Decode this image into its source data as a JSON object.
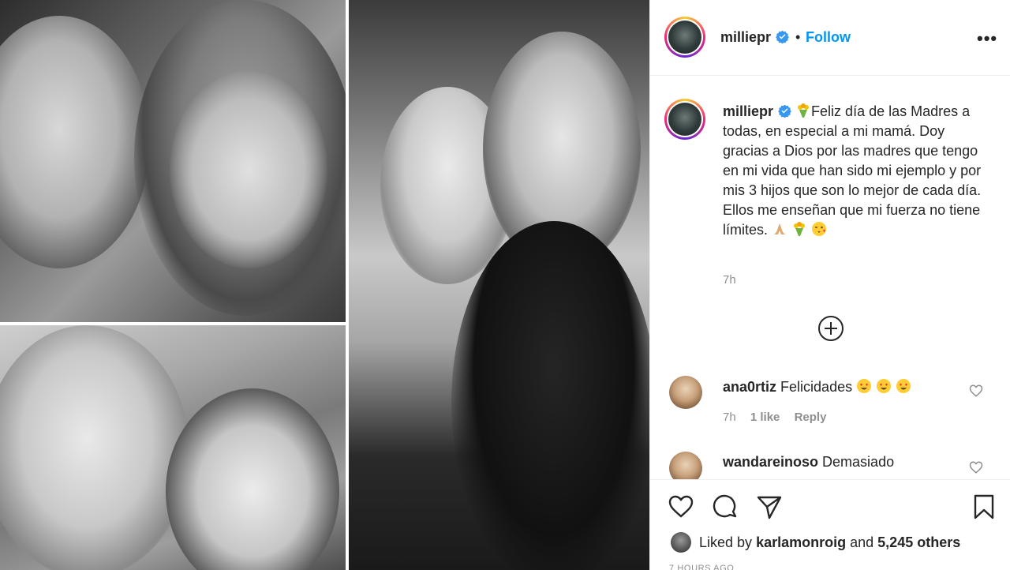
{
  "post": {
    "username": "milliepr",
    "header_separator": "•",
    "follow_label": "Follow",
    "more_label": "•••",
    "caption_text": "Feliz día de las Madres a todas, en especial a mi mamá. Doy gracias a Dios por las madres que tengo en mi vida que han sido mi ejemplo y por mis 3 hijos que son lo mejor de cada día. Ellos me enseñan que mi fuerza no tiene límites.",
    "caption_time": "7h",
    "time_ago": "7 HOURS AGO"
  },
  "comments": [
    {
      "username": "ana0rtiz",
      "text": "Felicidades",
      "time": "7h",
      "likes": "1 like",
      "reply_label": "Reply"
    },
    {
      "username": "wandareinoso",
      "text": "Demasiado"
    }
  ],
  "likes": {
    "prefix": "Liked by",
    "user": "karlamonroig",
    "connector": "and",
    "count": "5,245 others"
  },
  "colors": {
    "accent": "#0095f6",
    "muted": "#8e8e8e",
    "text": "#262626"
  },
  "icons": [
    "verified-icon",
    "more-icon",
    "bouquet-icon",
    "pray-icon",
    "wink-kiss-icon",
    "heart-eyes-icon",
    "plus-circle-icon",
    "heart-icon",
    "comment-icon",
    "share-icon",
    "bookmark-icon"
  ]
}
